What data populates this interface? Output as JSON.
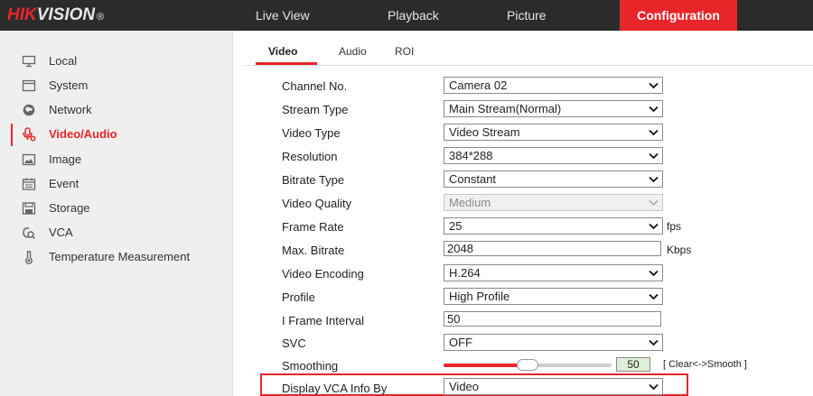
{
  "brand": {
    "name_red": "HIK",
    "name_light": "VISION",
    "reg": "®"
  },
  "topnav": [
    {
      "label": "Live View"
    },
    {
      "label": "Playback"
    },
    {
      "label": "Picture"
    },
    {
      "label": "Configuration",
      "active": true
    }
  ],
  "sidebar": {
    "items": [
      {
        "label": "Local",
        "icon": "monitor-icon"
      },
      {
        "label": "System",
        "icon": "system-icon"
      },
      {
        "label": "Network",
        "icon": "globe-icon"
      },
      {
        "label": "Video/Audio",
        "icon": "video-audio-icon",
        "active": true
      },
      {
        "label": "Image",
        "icon": "image-icon"
      },
      {
        "label": "Event",
        "icon": "calendar-icon"
      },
      {
        "label": "Storage",
        "icon": "storage-icon"
      },
      {
        "label": "VCA",
        "icon": "vca-icon"
      },
      {
        "label": "Temperature Measurement",
        "icon": "temperature-icon"
      }
    ]
  },
  "tabs": [
    {
      "label": "Video",
      "active": true
    },
    {
      "label": "Audio"
    },
    {
      "label": "ROI"
    }
  ],
  "form": {
    "channel_no": {
      "label": "Channel No.",
      "value": "Camera 02"
    },
    "stream_type": {
      "label": "Stream Type",
      "value": "Main Stream(Normal)"
    },
    "video_type": {
      "label": "Video Type",
      "value": "Video Stream"
    },
    "resolution": {
      "label": "Resolution",
      "value": "384*288"
    },
    "bitrate_type": {
      "label": "Bitrate Type",
      "value": "Constant"
    },
    "video_quality": {
      "label": "Video Quality",
      "value": "Medium"
    },
    "frame_rate": {
      "label": "Frame Rate",
      "value": "25",
      "unit": "fps"
    },
    "max_bitrate": {
      "label": "Max. Bitrate",
      "value": "2048",
      "unit": "Kbps"
    },
    "video_encoding": {
      "label": "Video Encoding",
      "value": "H.264"
    },
    "profile": {
      "label": "Profile",
      "value": "High Profile"
    },
    "i_frame_interval": {
      "label": "I Frame Interval",
      "value": "50"
    },
    "svc": {
      "label": "SVC",
      "value": "OFF"
    },
    "smoothing": {
      "label": "Smoothing",
      "value": "50",
      "hint": "[ Clear<->Smooth ]",
      "level_percent": 50
    },
    "display_vca_info_by": {
      "label": "Display VCA Info By",
      "value": "Video"
    }
  },
  "colors": {
    "accent": "#e8262a",
    "topbar": "#2b2b2b",
    "sidebar": "#efefef"
  }
}
